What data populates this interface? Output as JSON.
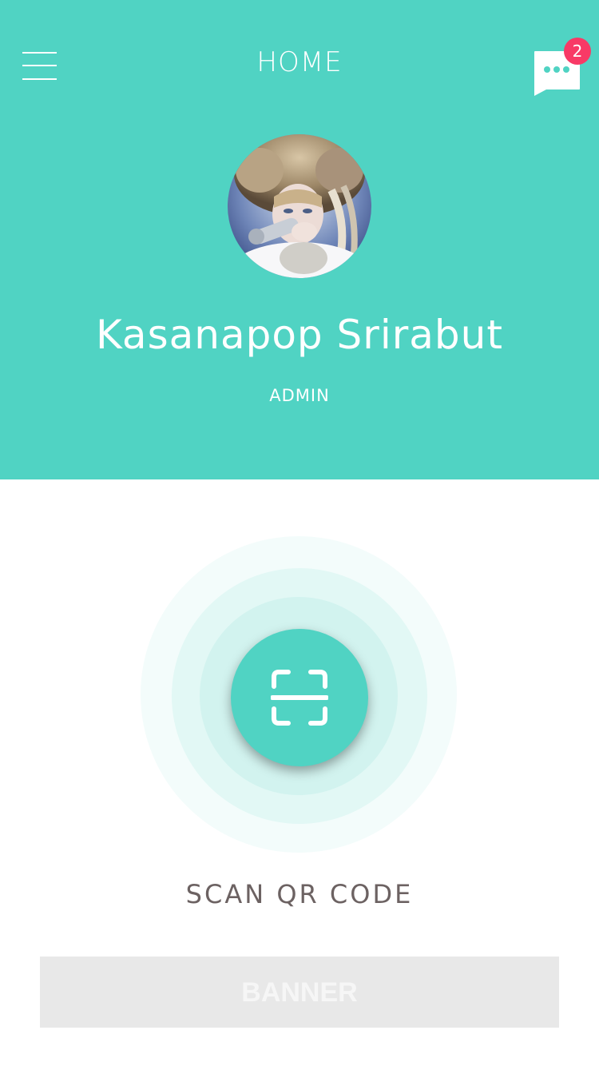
{
  "header": {
    "title": "HOME",
    "background": "#50d3c3",
    "menu_icon": "hamburger-menu-icon",
    "chat_icon": "chat-bubble-icon",
    "notification_count": "2",
    "badge_color": "#f83a66"
  },
  "profile": {
    "name": "Kasanapop Srirabut",
    "role": "ADMIN"
  },
  "scan": {
    "icon": "qr-scan-icon",
    "label": "SCAN QR CODE"
  },
  "banner": {
    "label": "BANNER"
  }
}
